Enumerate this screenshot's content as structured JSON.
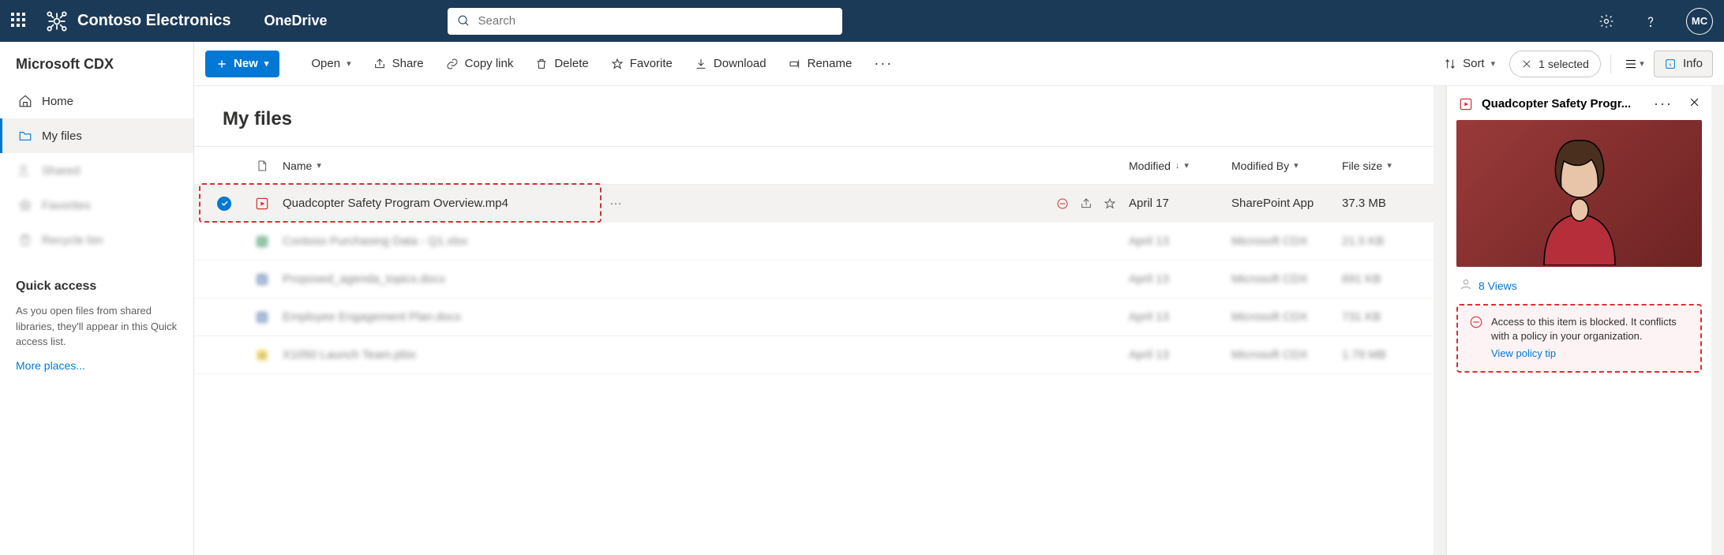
{
  "header": {
    "brand": "Contoso Electronics",
    "app": "OneDrive",
    "searchPlaceholder": "Search",
    "avatar": "MC"
  },
  "sidebar": {
    "title": "Microsoft CDX",
    "items": [
      {
        "label": "Home"
      },
      {
        "label": "My files"
      },
      {
        "label": "Shared"
      },
      {
        "label": "Favorites"
      },
      {
        "label": "Recycle bin"
      }
    ],
    "quickTitle": "Quick access",
    "quickHelp": "As you open files from shared libraries, they'll appear in this Quick access list.",
    "moreLink": "More places..."
  },
  "toolbar": {
    "new": "New",
    "open": "Open",
    "share": "Share",
    "copy": "Copy link",
    "delete": "Delete",
    "favorite": "Favorite",
    "download": "Download",
    "rename": "Rename",
    "sort": "Sort",
    "selected": "1 selected",
    "info": "Info"
  },
  "page": {
    "title": "My files"
  },
  "columns": {
    "name": "Name",
    "modified": "Modified",
    "by": "Modified By",
    "size": "File size"
  },
  "rows": [
    {
      "name": "Quadcopter Safety Program Overview.mp4",
      "modified": "April 17",
      "by": "SharePoint App",
      "size": "37.3 MB"
    },
    {
      "name": "Contoso Purchasing Data - Q1.xlsx",
      "modified": "April 13",
      "by": "Microsoft CDX",
      "size": "21.5 KB"
    },
    {
      "name": "Proposed_agenda_topics.docx",
      "modified": "April 13",
      "by": "Microsoft CDX",
      "size": "691 KB"
    },
    {
      "name": "Employee Engagement Plan.docx",
      "modified": "April 13",
      "by": "Microsoft CDX",
      "size": "731 KB"
    },
    {
      "name": "X1050 Launch Team.pbix",
      "modified": "April 13",
      "by": "Microsoft CDX",
      "size": "1.79 MB"
    }
  ],
  "details": {
    "title": "Quadcopter Safety Progr...",
    "views": "8 Views",
    "alertText": "Access to this item is blocked. It conflicts with a policy in your organization.",
    "alertLink": "View policy tip"
  }
}
